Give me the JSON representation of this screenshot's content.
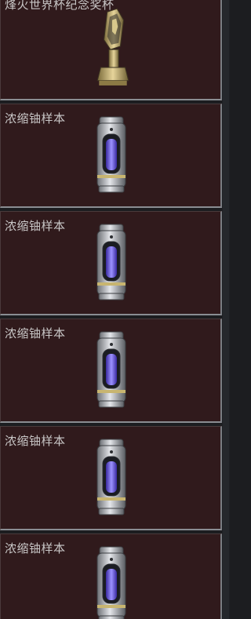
{
  "items": [
    {
      "title": "烽火世界杯纪念奖杯",
      "icon": "trophy-icon"
    },
    {
      "title": "浓缩铀样本",
      "icon": "uranium-canister-icon"
    },
    {
      "title": "浓缩铀样本",
      "icon": "uranium-canister-icon"
    },
    {
      "title": "浓缩铀样本",
      "icon": "uranium-canister-icon"
    },
    {
      "title": "浓缩铀样本",
      "icon": "uranium-canister-icon"
    },
    {
      "title": "浓缩铀样本",
      "icon": "uranium-canister-icon"
    }
  ],
  "colors": {
    "card_bg": "#301a1c",
    "card_border": "#8a8d92",
    "title_text": "#c8c6c6",
    "page_bg": "#1c1d20",
    "canister_glow": "#6a5cff"
  }
}
